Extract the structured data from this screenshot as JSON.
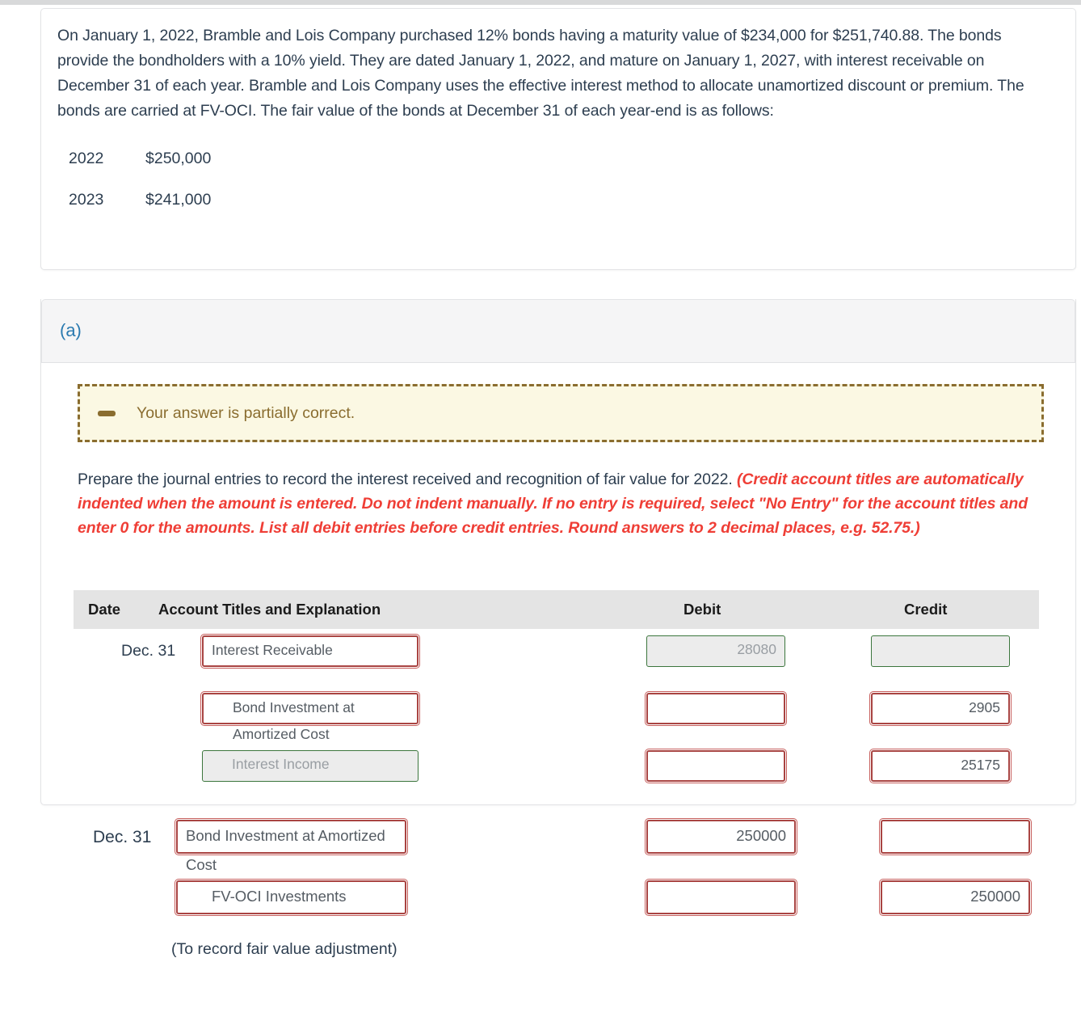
{
  "problem": {
    "statement": "On January 1, 2022, Bramble and Lois Company purchased 12% bonds having a maturity value of $234,000 for $251,740.88. The bonds provide the bondholders with a 10% yield. They are dated January 1, 2022, and mature on January 1, 2027, with interest receivable on December 31 of each year. Bramble and Lois Company uses the effective interest method to allocate unamortized discount or premium. The bonds are carried at FV-OCI. The fair value of the bonds at December 31 of each year-end is as follows:",
    "fair_values": [
      {
        "year": "2022",
        "value": "$250,000"
      },
      {
        "year": "2023",
        "value": "$241,000"
      }
    ]
  },
  "part_a": {
    "label": "(a)",
    "alert": {
      "icon": "minus-icon",
      "text": "Your answer is partially correct."
    },
    "instruction_plain": "Prepare the journal entries to record the interest received and recognition of fair value for 2022. ",
    "instruction_emphasis": "(Credit account titles are automatically indented when the amount is entered. Do not indent manually. If no entry is required, select \"No Entry\" for the account titles and enter 0 for the amounts. List all debit entries before credit entries. Round answers to 2 decimal places, e.g. 52.75.)",
    "table": {
      "headers": {
        "date": "Date",
        "account": "Account Titles and Explanation",
        "debit": "Debit",
        "credit": "Credit"
      },
      "entries": [
        {
          "date": "Dec. 31",
          "rows": [
            {
              "account": "Interest Receivable",
              "account_state": "error",
              "account_indent": false,
              "debit": "28080",
              "debit_state": "correct",
              "credit": "",
              "credit_state": "correct"
            },
            {
              "account": "Bond Investment at Amortized Cost",
              "account_state": "error",
              "account_indent": true,
              "debit": "",
              "debit_state": "error",
              "credit": "2905",
              "credit_state": "error"
            },
            {
              "account": "Interest Income",
              "account_state": "correct",
              "account_indent": true,
              "debit": "",
              "debit_state": "error",
              "credit": "25175",
              "credit_state": "error"
            }
          ]
        },
        {
          "date": "Dec. 31",
          "rows": [
            {
              "account": "Bond Investment at Amortized Cost",
              "account_state": "error",
              "account_indent": false,
              "debit": "250000",
              "debit_state": "error",
              "credit": "",
              "credit_state": "error"
            },
            {
              "account": "FV-OCI Investments",
              "account_state": "error",
              "account_indent": true,
              "debit": "",
              "debit_state": "error",
              "credit": "250000",
              "credit_state": "error"
            }
          ],
          "memo": "(To record fair value adjustment)"
        }
      ]
    }
  },
  "colors": {
    "error_border": "#a94442",
    "correct_border": "#3c763d",
    "alert_text": "#8a6d2f",
    "alert_bg": "#fbf8e3",
    "link_blue": "#2a7ab0",
    "emphasis_red": "#ef3e36"
  }
}
